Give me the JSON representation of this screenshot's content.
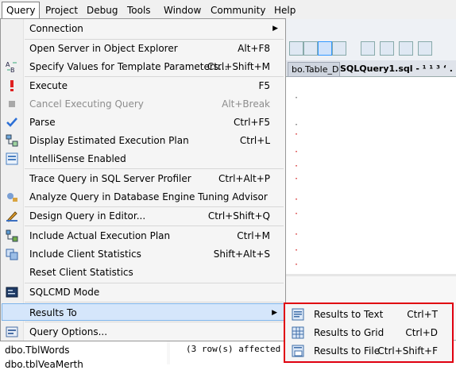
{
  "menubar": {
    "items": [
      "Query",
      "Project",
      "Debug",
      "Tools",
      "Window",
      "Community",
      "Help"
    ]
  },
  "editor": {
    "tabs": {
      "inactive": "bo.Table_D",
      "active": "SQLQuery1.sql - ¹ ¹ ³ ‘ . ’"
    }
  },
  "object_explorer": {
    "rows": [
      "dbo.TblWords",
      "dbo.tblVeaMerth"
    ]
  },
  "results": {
    "text": "(3 row(s) affected"
  },
  "query_menu": {
    "items": [
      {
        "label": "Connection",
        "shortcut": "",
        "submenu": true,
        "icon": ""
      },
      {
        "label": "Open Server in Object Explorer",
        "shortcut": "Alt+F8",
        "icon": ""
      },
      {
        "label": "Specify Values for Template Parameters...",
        "shortcut": "Ctrl+Shift+M",
        "icon": "template-params-icon"
      },
      {
        "label": "Execute",
        "shortcut": "F5",
        "icon": "execute-icon"
      },
      {
        "label": "Cancel Executing Query",
        "shortcut": "Alt+Break",
        "icon": "cancel-icon",
        "disabled": true
      },
      {
        "label": "Parse",
        "shortcut": "Ctrl+F5",
        "icon": "checkmark-icon"
      },
      {
        "label": "Display Estimated Execution Plan",
        "shortcut": "Ctrl+L",
        "icon": "execution-plan-icon"
      },
      {
        "label": "IntelliSense Enabled",
        "shortcut": "",
        "icon": "intellisense-icon"
      },
      {
        "label": "Trace Query in SQL Server Profiler",
        "shortcut": "Ctrl+Alt+P",
        "icon": ""
      },
      {
        "label": "Analyze Query in Database Engine Tuning Advisor",
        "shortcut": "",
        "icon": "tuning-advisor-icon"
      },
      {
        "label": "Design Query in Editor...",
        "shortcut": "Ctrl+Shift+Q",
        "icon": "design-query-icon"
      },
      {
        "label": "Include Actual Execution Plan",
        "shortcut": "Ctrl+M",
        "icon": "actual-plan-icon"
      },
      {
        "label": "Include Client Statistics",
        "shortcut": "Shift+Alt+S",
        "icon": "client-stats-icon"
      },
      {
        "label": "Reset Client Statistics",
        "shortcut": "",
        "icon": ""
      },
      {
        "label": "SQLCMD Mode",
        "shortcut": "",
        "icon": "sqlcmd-icon"
      },
      {
        "label": "Results To",
        "shortcut": "",
        "submenu": true,
        "icon": "",
        "highlighted": true
      },
      {
        "label": "Query Options...",
        "shortcut": "",
        "icon": "query-options-icon"
      }
    ]
  },
  "results_to_submenu": {
    "items": [
      {
        "label": "Results to Text",
        "shortcut": "Ctrl+T",
        "icon": "results-to-text-icon"
      },
      {
        "label": "Results to Grid",
        "shortcut": "Ctrl+D",
        "icon": "results-to-grid-icon"
      },
      {
        "label": "Results to File",
        "shortcut": "Ctrl+Shift+F",
        "icon": "results-to-file-icon"
      }
    ]
  },
  "colors": {
    "highlight_box": "#e0000f",
    "menu_hover": "#d5e6fb",
    "menu_hover_border": "#7eb4ea"
  }
}
